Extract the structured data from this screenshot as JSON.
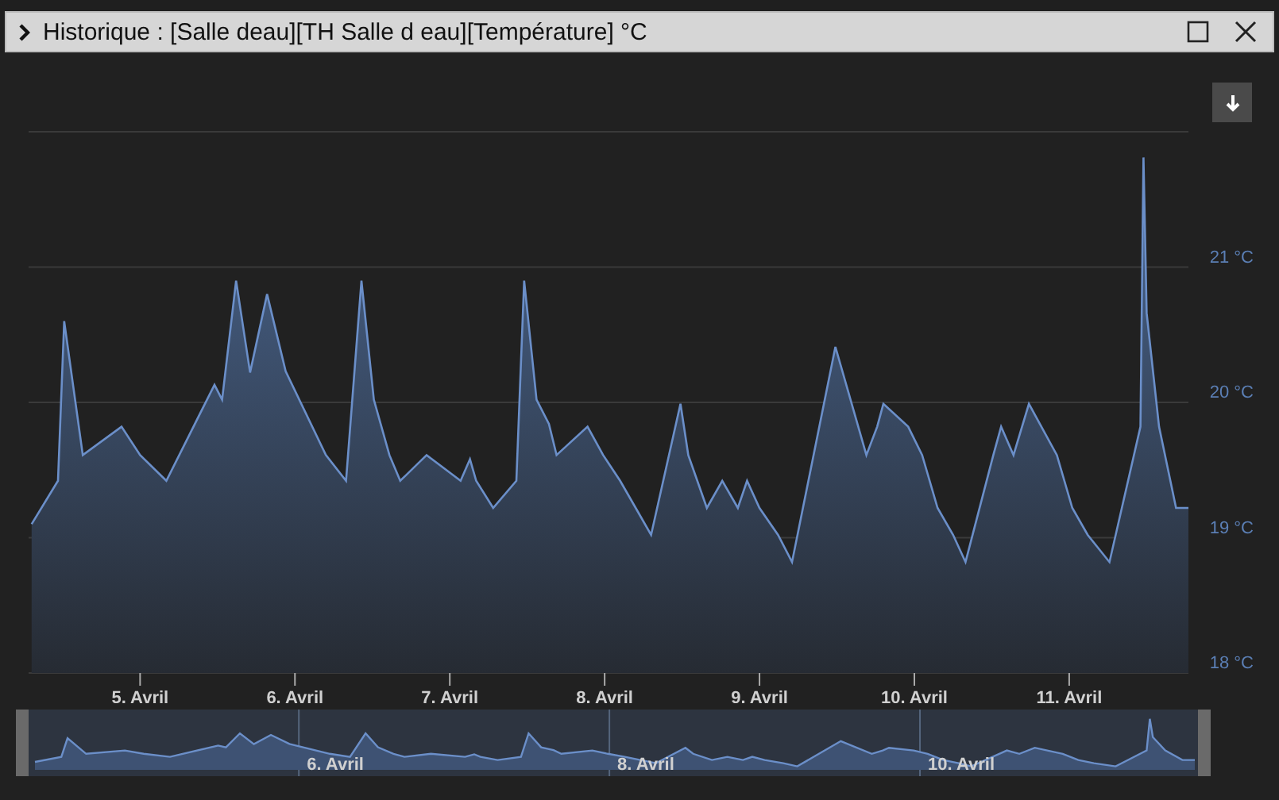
{
  "window": {
    "title": "Historique : [Salle deau][TH Salle d eau][Température] °C"
  },
  "chart": {
    "chart_data": {
      "type": "area",
      "grid": true,
      "xlim": [
        4.28,
        11.77
      ],
      "ylim": [
        18,
        22
      ],
      "xticks": [
        {
          "value": 5,
          "label": "5. Avril"
        },
        {
          "value": 6,
          "label": "6. Avril"
        },
        {
          "value": 7,
          "label": "7. Avril"
        },
        {
          "value": 8,
          "label": "8. Avril"
        },
        {
          "value": 9,
          "label": "9. Avril"
        },
        {
          "value": 10,
          "label": "10. Avril"
        },
        {
          "value": 11,
          "label": "11. Avril"
        }
      ],
      "yticks": [
        {
          "value": 18,
          "label": "18 °C"
        },
        {
          "value": 19,
          "label": "19 °C"
        },
        {
          "value": 20,
          "label": "20 °C"
        },
        {
          "value": 21,
          "label": "21 °C"
        }
      ],
      "x": [
        4.3,
        4.47,
        4.51,
        4.63,
        4.88,
        5.0,
        5.17,
        5.48,
        5.53,
        5.62,
        5.71,
        5.82,
        5.94,
        6.2,
        6.33,
        6.43,
        6.51,
        6.61,
        6.68,
        6.85,
        7.07,
        7.13,
        7.17,
        7.28,
        7.43,
        7.48,
        7.56,
        7.64,
        7.69,
        7.89,
        7.99,
        8.1,
        8.2,
        8.3,
        8.49,
        8.54,
        8.66,
        8.76,
        8.86,
        8.92,
        9.0,
        9.12,
        9.21,
        9.49,
        9.69,
        9.76,
        9.8,
        9.96,
        10.05,
        10.15,
        10.25,
        10.33,
        10.51,
        10.56,
        10.64,
        10.74,
        10.92,
        11.02,
        11.12,
        11.26,
        11.46,
        11.48,
        11.5,
        11.58,
        11.69,
        11.77
      ],
      "series": [
        {
          "color": "#6b8fc9",
          "values": [
            19.1,
            19.42,
            20.6,
            19.61,
            19.82,
            19.61,
            19.42,
            20.13,
            20.02,
            20.9,
            20.22,
            20.8,
            20.23,
            19.61,
            19.42,
            20.9,
            20.02,
            19.61,
            19.42,
            19.61,
            19.42,
            19.58,
            19.42,
            19.22,
            19.42,
            20.9,
            20.02,
            19.84,
            19.61,
            19.82,
            19.61,
            19.42,
            19.22,
            19.02,
            19.99,
            19.61,
            19.22,
            19.42,
            19.22,
            19.42,
            19.22,
            19.02,
            18.82,
            20.41,
            19.61,
            19.82,
            19.99,
            19.82,
            19.61,
            19.22,
            19.02,
            18.82,
            19.61,
            19.82,
            19.61,
            19.99,
            19.61,
            19.22,
            19.02,
            18.82,
            19.82,
            21.81,
            20.66,
            19.82,
            19.22,
            19.22
          ]
        }
      ]
    }
  },
  "navigator": {
    "labels": [
      "6. Avril",
      "8. Avril",
      "10. Avril"
    ]
  }
}
